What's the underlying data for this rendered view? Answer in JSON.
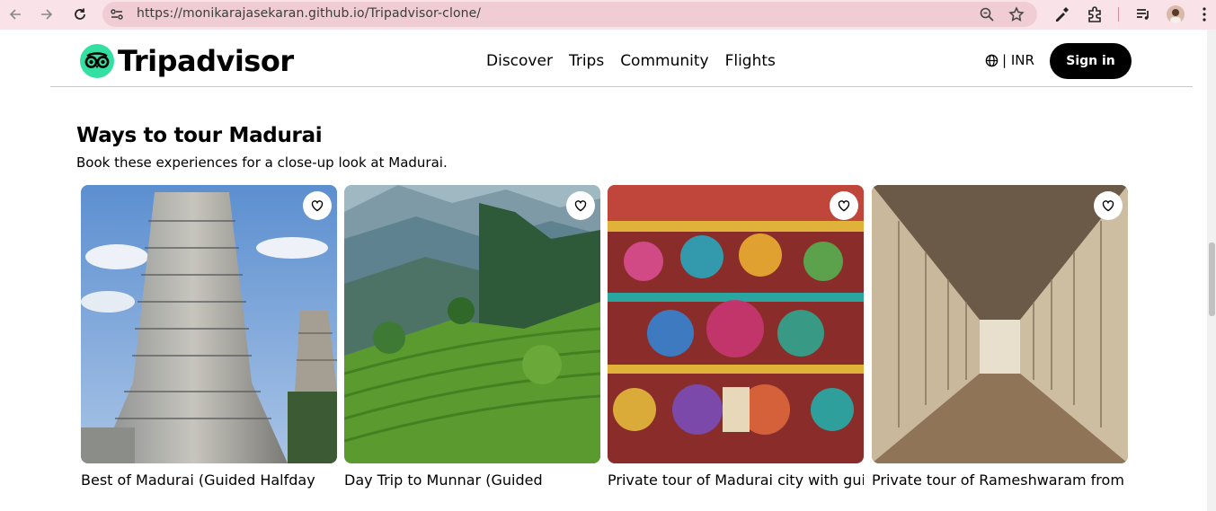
{
  "browser": {
    "url": "https://monikarajasekaran.github.io/Tripadvisor-clone/"
  },
  "header": {
    "logo_text": "Tripadvisor",
    "nav": [
      "Discover",
      "Trips",
      "Community",
      "Flights"
    ],
    "currency": "| INR",
    "signin_label": "Sign in"
  },
  "section": {
    "title": "Ways to tour Madurai",
    "subtitle": "Book these experiences for a close-up look at Madurai."
  },
  "cards": [
    {
      "title": "Best of Madurai (Guided Halfday",
      "image": "temple-gopuram"
    },
    {
      "title": "Day Trip to Munnar (Guided",
      "image": "tea-hills"
    },
    {
      "title": "Private tour of Madurai city with guide",
      "image": "temple-sculptures"
    },
    {
      "title": "Private tour of Rameshwaram from",
      "image": "temple-corridor"
    }
  ],
  "colors": {
    "brand_green": "#34e0a1",
    "chrome_bg": "#f9e3e8",
    "omnibox_bg": "#f0cdd5"
  }
}
